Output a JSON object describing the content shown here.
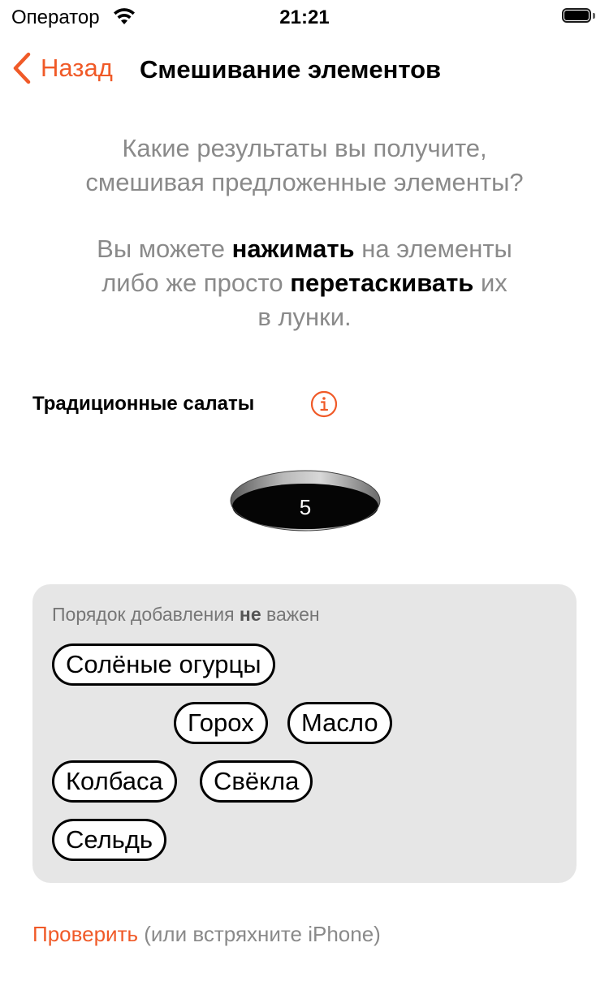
{
  "status_bar": {
    "carrier": "Оператор",
    "time": "21:21"
  },
  "nav": {
    "back_label": "Назад",
    "title": "Смешивание элементов"
  },
  "intro": {
    "question_line1": "Какие результаты вы получите,",
    "question_line2": "смешивая предложенные элементы?",
    "instr_a": "Вы можете ",
    "instr_b": "нажимать",
    "instr_c": " на элементы",
    "instr_d": "либо же просто ",
    "instr_e": "перетаскивать",
    "instr_f": " их",
    "instr_g": "в лунки."
  },
  "section": {
    "title": "Традиционные салаты"
  },
  "hole": {
    "count": "5"
  },
  "panel": {
    "hint_a": "Порядок добавления ",
    "hint_b": "не",
    "hint_c": " важен",
    "chips": [
      "Солёные огурцы",
      "Горох",
      "Масло",
      "Колбаса",
      "Свёкла",
      "Сельдь"
    ]
  },
  "footer": {
    "check_label": "Проверить",
    "note": " (или встряхните iPhone)"
  },
  "colors": {
    "accent": "#f05a28",
    "panel_bg": "#e6e6e6",
    "muted_text": "#8a8a8a"
  }
}
